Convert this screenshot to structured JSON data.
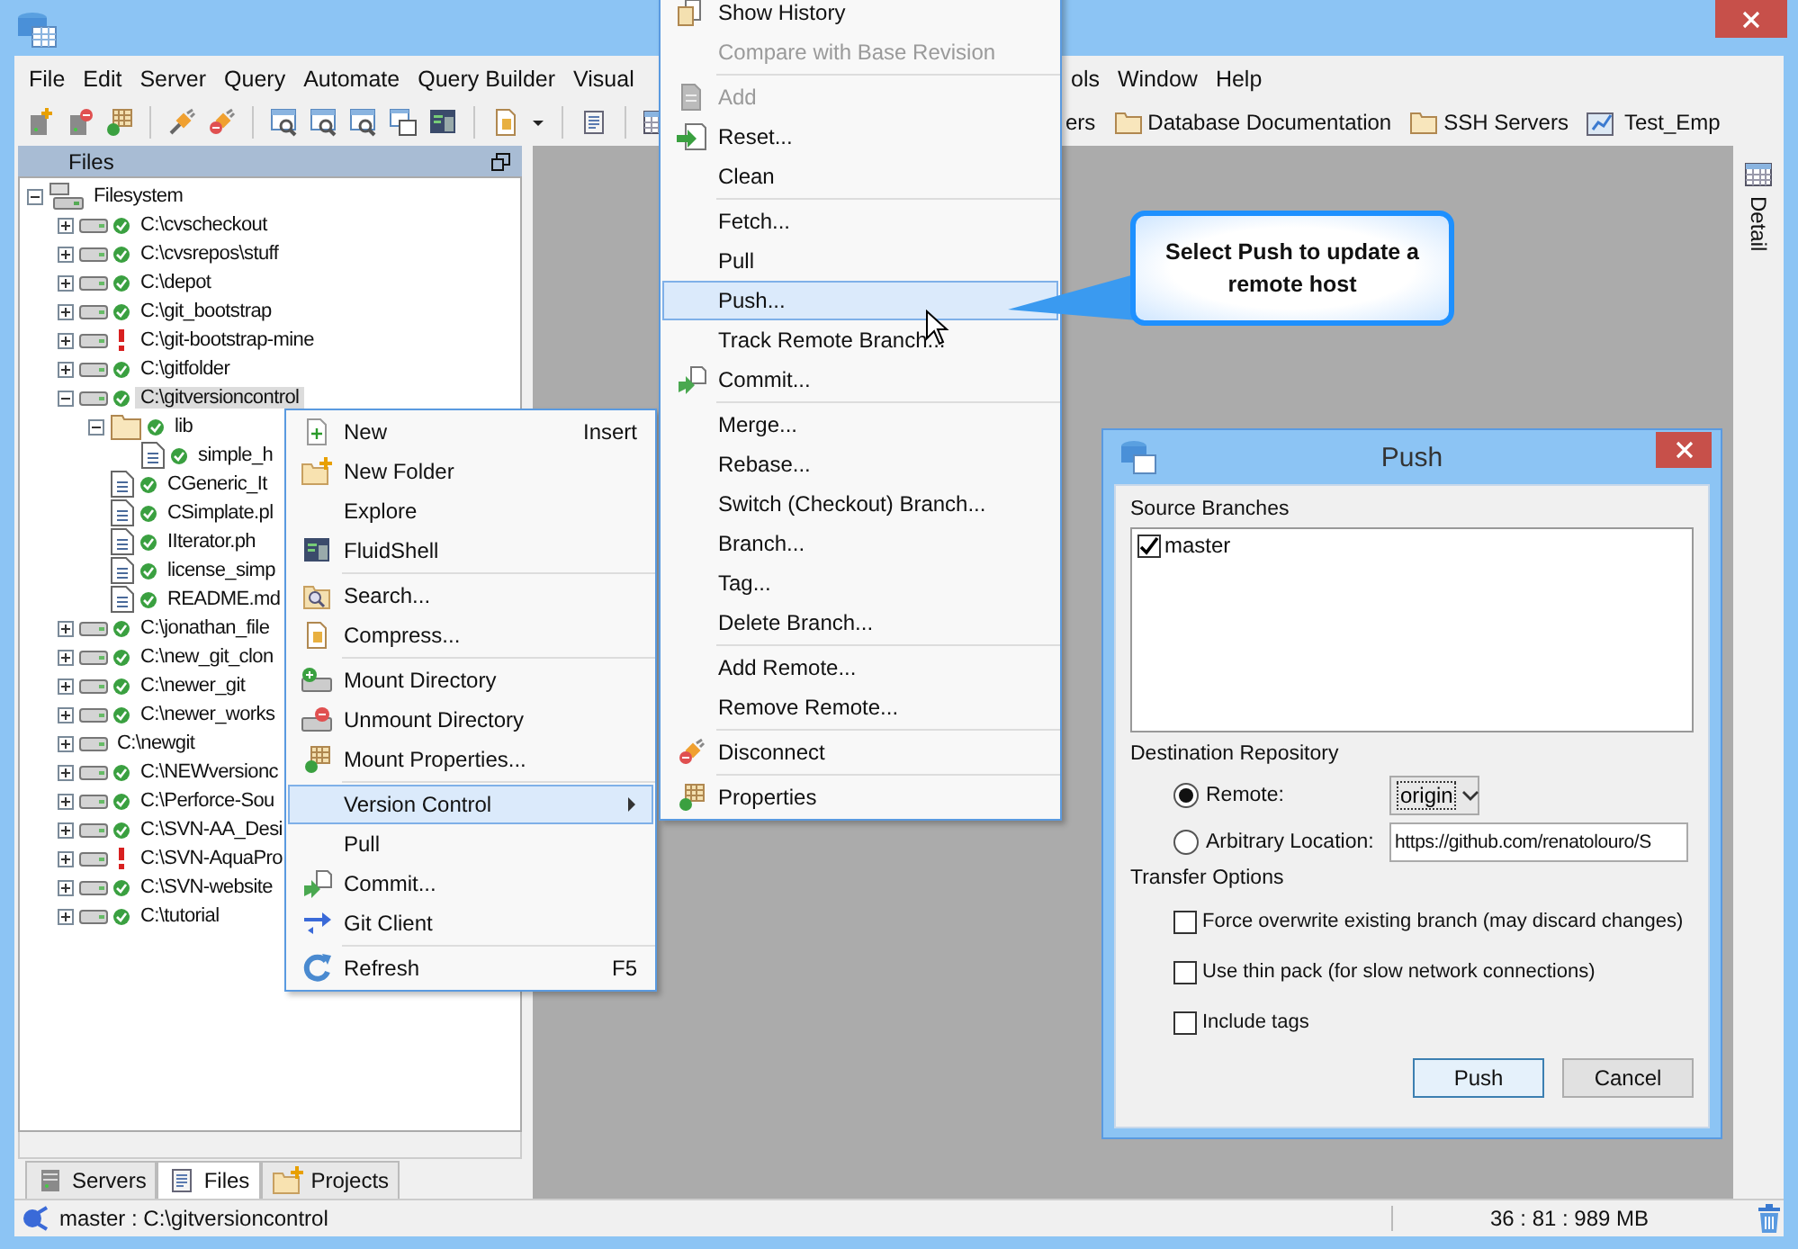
{
  "menu_bar": [
    "File",
    "Edit",
    "Server",
    "Query",
    "Automate",
    "Query Builder",
    "Visual",
    "ols",
    "Window",
    "Help"
  ],
  "bookmarks": [
    {
      "label": "ers",
      "kind": "none"
    },
    {
      "label": "Database Documentation",
      "kind": "folder"
    },
    {
      "label": "SSH Servers",
      "kind": "folder"
    },
    {
      "label": "Test_Emp",
      "kind": "connection"
    }
  ],
  "files_panel": {
    "title": "Files",
    "tree": [
      {
        "label": "Filesystem",
        "kind": "root",
        "expanded": true,
        "selected": false,
        "children": [
          {
            "label": "C:\\cvscheckout",
            "kind": "drive",
            "versioned": true,
            "error": false,
            "expanded": false,
            "selected": false
          },
          {
            "label": "C:\\cvsrepos\\stuff",
            "kind": "drive",
            "versioned": true,
            "error": false,
            "expanded": false,
            "selected": false
          },
          {
            "label": "C:\\depot",
            "kind": "drive",
            "versioned": true,
            "error": false,
            "expanded": false,
            "selected": false
          },
          {
            "label": "C:\\git_bootstrap",
            "kind": "drive",
            "versioned": true,
            "error": false,
            "expanded": false,
            "selected": false
          },
          {
            "label": "C:\\git-bootstrap-mine",
            "kind": "drive",
            "versioned": false,
            "error": true,
            "expanded": false,
            "selected": false
          },
          {
            "label": "C:\\gitfolder",
            "kind": "drive",
            "versioned": true,
            "error": false,
            "expanded": false,
            "selected": false
          },
          {
            "label": "C:\\gitversioncontrol",
            "kind": "drive",
            "versioned": true,
            "error": false,
            "expanded": true,
            "selected": true,
            "children": [
              {
                "label": "lib",
                "kind": "folder",
                "versioned": true,
                "error": false,
                "expanded": true,
                "selected": false,
                "children": [
                  {
                    "label": "simple_h",
                    "kind": "file",
                    "versioned": true,
                    "error": false,
                    "selected": false
                  }
                ]
              },
              {
                "label": "CGeneric_It",
                "kind": "file",
                "versioned": true,
                "error": false,
                "selected": false
              },
              {
                "label": "CSimplate.pl",
                "kind": "file",
                "versioned": true,
                "error": false,
                "selected": false
              },
              {
                "label": "IIterator.ph",
                "kind": "file",
                "versioned": true,
                "error": false,
                "selected": false
              },
              {
                "label": "license_simp",
                "kind": "file",
                "versioned": true,
                "error": false,
                "selected": false
              },
              {
                "label": "README.md",
                "kind": "file",
                "versioned": true,
                "error": false,
                "selected": false
              }
            ]
          },
          {
            "label": "C:\\jonathan_file",
            "kind": "drive",
            "versioned": true,
            "error": false,
            "expanded": false,
            "selected": false
          },
          {
            "label": "C:\\new_git_clon",
            "kind": "drive",
            "versioned": true,
            "error": false,
            "expanded": false,
            "selected": false
          },
          {
            "label": "C:\\newer_git",
            "kind": "drive",
            "versioned": true,
            "error": false,
            "expanded": false,
            "selected": false
          },
          {
            "label": "C:\\newer_works",
            "kind": "drive",
            "versioned": true,
            "error": false,
            "expanded": false,
            "selected": false
          },
          {
            "label": "C:\\newgit",
            "kind": "drive",
            "versioned": false,
            "error": false,
            "expanded": false,
            "selected": false
          },
          {
            "label": "C:\\NEWversionc",
            "kind": "drive",
            "versioned": true,
            "error": false,
            "expanded": false,
            "selected": false
          },
          {
            "label": "C:\\Perforce-Sou",
            "kind": "drive",
            "versioned": true,
            "error": false,
            "expanded": false,
            "selected": false
          },
          {
            "label": "C:\\SVN-AA_Desi",
            "kind": "drive",
            "versioned": true,
            "error": false,
            "expanded": false,
            "selected": false
          },
          {
            "label": "C:\\SVN-AquaPro",
            "kind": "drive",
            "versioned": false,
            "error": true,
            "expanded": false,
            "selected": false
          },
          {
            "label": "C:\\SVN-website",
            "kind": "drive",
            "versioned": true,
            "error": false,
            "expanded": false,
            "selected": false
          },
          {
            "label": "C:\\tutorial",
            "kind": "drive",
            "versioned": true,
            "error": false,
            "expanded": false,
            "selected": false
          }
        ]
      }
    ]
  },
  "bottom_tabs": [
    {
      "label": "Servers",
      "selected": false
    },
    {
      "label": "Files",
      "selected": true
    },
    {
      "label": "Projects",
      "selected": false
    }
  ],
  "side_tab": "Detail",
  "context_menu": {
    "groups": [
      [
        {
          "label": "New",
          "shortcut": "Insert",
          "selected": false,
          "submenu": false
        },
        {
          "label": "New Folder",
          "selected": false,
          "submenu": false
        },
        {
          "label": "Explore",
          "selected": false,
          "submenu": false
        },
        {
          "label": "FluidShell",
          "selected": false,
          "submenu": false
        }
      ],
      [
        {
          "label": "Search...",
          "selected": false,
          "submenu": false
        },
        {
          "label": "Compress...",
          "selected": false,
          "submenu": false
        }
      ],
      [
        {
          "label": "Mount Directory",
          "selected": false,
          "submenu": false
        },
        {
          "label": "Unmount Directory",
          "selected": false,
          "submenu": false
        },
        {
          "label": "Mount Properties...",
          "selected": false,
          "submenu": false
        }
      ],
      [
        {
          "label": "Version Control",
          "selected": true,
          "submenu": true
        },
        {
          "label": "Pull",
          "selected": false,
          "submenu": false
        },
        {
          "label": "Commit...",
          "selected": false,
          "submenu": false
        },
        {
          "label": "Git Client",
          "selected": false,
          "submenu": false
        }
      ],
      [
        {
          "label": "Refresh",
          "shortcut": "F5",
          "selected": false,
          "submenu": false
        }
      ]
    ]
  },
  "version_control_menu": {
    "groups": [
      [
        {
          "label": "Show History",
          "selected": false,
          "disabled": false
        },
        {
          "label": "Compare with Base Revision",
          "selected": false,
          "disabled": true
        }
      ],
      [
        {
          "label": "Add",
          "selected": false,
          "disabled": true
        },
        {
          "label": "Reset...",
          "selected": false,
          "disabled": false
        },
        {
          "label": "Clean",
          "selected": false,
          "disabled": false
        }
      ],
      [
        {
          "label": "Fetch...",
          "selected": false,
          "disabled": false
        },
        {
          "label": "Pull",
          "selected": false,
          "disabled": false
        },
        {
          "label": "Push...",
          "selected": true,
          "disabled": false
        },
        {
          "label": "Track Remote Branch...",
          "selected": false,
          "disabled": false
        },
        {
          "label": "Commit...",
          "selected": false,
          "disabled": false
        }
      ],
      [
        {
          "label": "Merge...",
          "selected": false,
          "disabled": false
        },
        {
          "label": "Rebase...",
          "selected": false,
          "disabled": false
        },
        {
          "label": "Switch (Checkout) Branch...",
          "selected": false,
          "disabled": false
        },
        {
          "label": "Branch...",
          "selected": false,
          "disabled": false
        },
        {
          "label": "Tag...",
          "selected": false,
          "disabled": false
        },
        {
          "label": "Delete Branch...",
          "selected": false,
          "disabled": false
        }
      ],
      [
        {
          "label": "Add Remote...",
          "selected": false,
          "disabled": false
        },
        {
          "label": "Remove Remote...",
          "selected": false,
          "disabled": false
        }
      ],
      [
        {
          "label": "Disconnect",
          "selected": false,
          "disabled": false
        }
      ],
      [
        {
          "label": "Properties",
          "selected": false,
          "disabled": false
        }
      ]
    ]
  },
  "callout": "Select Push to update a remote host",
  "push_dialog": {
    "title": "Push",
    "source_branches": {
      "label": "Source Branches",
      "items": [
        {
          "label": "master",
          "checked": true
        }
      ]
    },
    "destination": {
      "label": "Destination Repository",
      "options": [
        {
          "label": "Remote:",
          "selected": true,
          "kind": "dropdown",
          "value": "origin"
        },
        {
          "label": "Arbitrary Location:",
          "selected": false,
          "kind": "text",
          "value": "https://github.com/renatolouro/S"
        }
      ]
    },
    "transfer_options": {
      "label": "Transfer Options",
      "options": [
        {
          "label": "Force overwrite existing branch (may discard changes)",
          "checked": false
        },
        {
          "label": "Use thin pack (for slow network connections)",
          "checked": false
        },
        {
          "label": "Include tags",
          "checked": false
        }
      ]
    },
    "buttons": [
      {
        "label": "Push",
        "default": true
      },
      {
        "label": "Cancel",
        "default": false
      }
    ]
  },
  "status_bar": {
    "branch": "master : C:\\gitversioncontrol",
    "memory": "36 : 81 : 989 MB"
  }
}
